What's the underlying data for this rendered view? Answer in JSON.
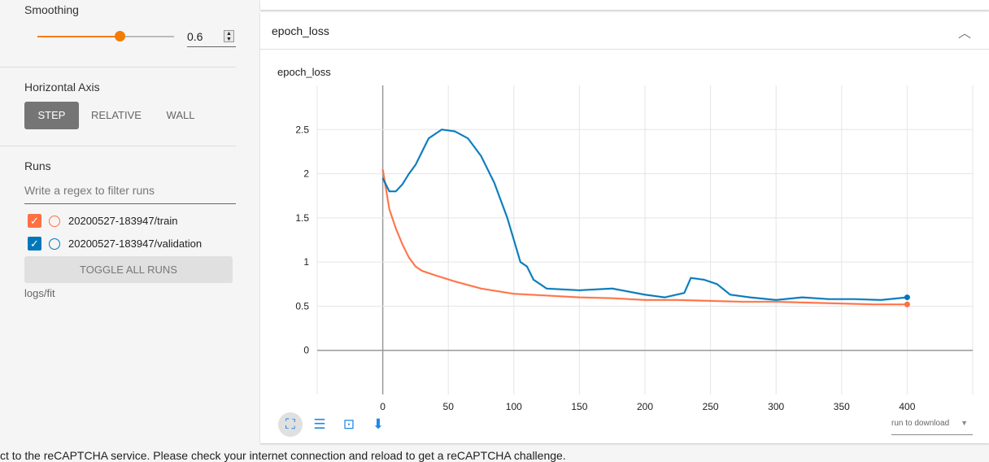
{
  "sidebar": {
    "smoothing": {
      "label": "Smoothing",
      "value": "0.6",
      "fraction": 0.6
    },
    "horizontal_axis": {
      "label": "Horizontal Axis",
      "options": [
        "STEP",
        "RELATIVE",
        "WALL"
      ],
      "selected": "STEP"
    },
    "runs": {
      "label": "Runs",
      "filter_placeholder": "Write a regex to filter runs",
      "items": [
        {
          "name": "20200527-183947/train",
          "color": "#ff7043",
          "checked": true
        },
        {
          "name": "20200527-183947/validation",
          "color": "#0077bb",
          "checked": true
        }
      ],
      "toggle_label": "TOGGLE ALL RUNS",
      "logdir": "logs/fit"
    }
  },
  "card": {
    "title": "epoch_loss",
    "chart_title": "epoch_loss",
    "download_label": "run to download"
  },
  "footer": {
    "recaptcha": "ct to the reCAPTCHA service. Please check your internet connection and reload to get a reCAPTCHA challenge."
  },
  "chart_data": {
    "type": "line",
    "title": "epoch_loss",
    "xlabel": "step",
    "ylabel": "",
    "xlim": [
      -50,
      450
    ],
    "ylim": [
      -0.5,
      3.0
    ],
    "xticks": [
      0,
      50,
      100,
      150,
      200,
      250,
      300,
      350,
      400
    ],
    "yticks": [
      0,
      0.5,
      1,
      1.5,
      2,
      2.5
    ],
    "ytick_labels": [
      "0",
      "0.5",
      "1",
      "1.5",
      "2",
      "2.5"
    ],
    "series": [
      {
        "name": "20200527-183947/train",
        "color": "#ff7043",
        "x": [
          0,
          5,
          10,
          15,
          20,
          25,
          30,
          40,
          55,
          75,
          100,
          125,
          150,
          175,
          200,
          225,
          250,
          275,
          300,
          325,
          350,
          375,
          400
        ],
        "y": [
          2.05,
          1.6,
          1.38,
          1.2,
          1.05,
          0.95,
          0.9,
          0.85,
          0.78,
          0.7,
          0.64,
          0.62,
          0.6,
          0.59,
          0.57,
          0.57,
          0.56,
          0.55,
          0.55,
          0.54,
          0.53,
          0.52,
          0.52
        ]
      },
      {
        "name": "20200527-183947/validation",
        "color": "#0077bb",
        "x": [
          0,
          5,
          10,
          15,
          20,
          25,
          30,
          35,
          45,
          55,
          65,
          75,
          85,
          95,
          105,
          110,
          115,
          125,
          150,
          175,
          200,
          215,
          230,
          235,
          245,
          255,
          265,
          280,
          300,
          320,
          340,
          360,
          380,
          400
        ],
        "y": [
          1.95,
          1.8,
          1.8,
          1.88,
          2.0,
          2.1,
          2.25,
          2.4,
          2.5,
          2.48,
          2.4,
          2.2,
          1.9,
          1.5,
          1.0,
          0.95,
          0.8,
          0.7,
          0.68,
          0.7,
          0.63,
          0.6,
          0.65,
          0.82,
          0.8,
          0.75,
          0.63,
          0.6,
          0.57,
          0.6,
          0.58,
          0.58,
          0.57,
          0.6
        ]
      }
    ]
  }
}
